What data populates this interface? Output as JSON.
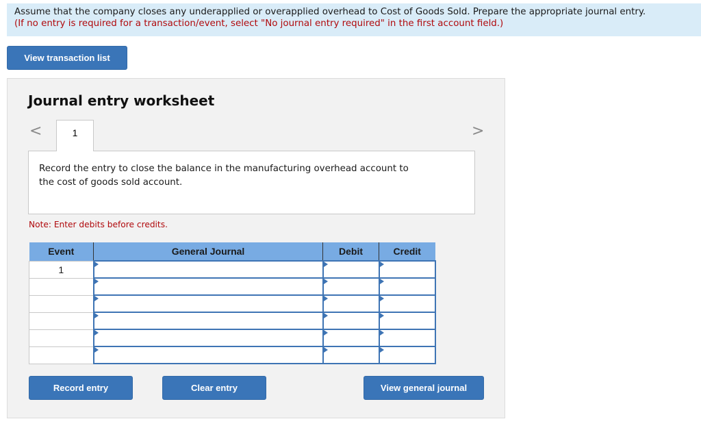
{
  "instructions": {
    "line1": "Assume that the company closes any underapplied or overapplied overhead to Cost of Goods Sold. Prepare the appropriate journal entry.",
    "line2": "(If no entry is required for a transaction/event, select \"No journal entry required\" in the first account field.)"
  },
  "buttons": {
    "view_transaction_list": "View transaction list",
    "record_entry": "Record entry",
    "clear_entry": "Clear entry",
    "view_general_journal": "View general journal"
  },
  "worksheet": {
    "title": "Journal entry worksheet",
    "nav_prev": "<",
    "nav_next": ">",
    "tabs": [
      {
        "label": "1",
        "active": true
      }
    ],
    "prompt": "Record the entry to close the balance in the manufacturing overhead account to the cost of goods sold account.",
    "note": "Note: Enter debits before credits."
  },
  "journal": {
    "headers": {
      "event": "Event",
      "general_journal": "General Journal",
      "debit": "Debit",
      "credit": "Credit"
    },
    "rows": [
      {
        "event": "1",
        "account": "",
        "debit": "",
        "credit": ""
      },
      {
        "event": "",
        "account": "",
        "debit": "",
        "credit": ""
      },
      {
        "event": "",
        "account": "",
        "debit": "",
        "credit": ""
      },
      {
        "event": "",
        "account": "",
        "debit": "",
        "credit": ""
      },
      {
        "event": "",
        "account": "",
        "debit": "",
        "credit": ""
      },
      {
        "event": "",
        "account": "",
        "debit": "",
        "credit": ""
      }
    ]
  },
  "colors": {
    "accent": "#3a75b8",
    "header_blue": "#78abe3",
    "instruction_bg": "#d9ecf8",
    "warning_red": "#b0090c"
  }
}
